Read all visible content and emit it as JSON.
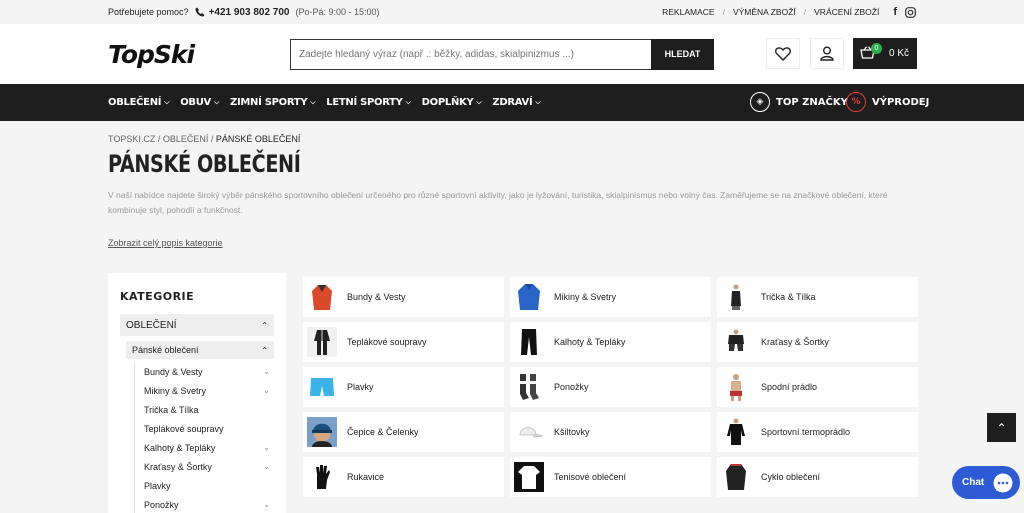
{
  "topbar": {
    "help": "Potřebujete pomoc?",
    "phone": "+421 903 802 700",
    "hours": "(Po-Pá: 9:00 - 15:00)",
    "links": [
      "REKLAMACE",
      "VÝMĚNA ZBOŽÍ",
      "VRÁCENÍ ZBOŽÍ"
    ]
  },
  "header": {
    "logo": "TopSki",
    "search_placeholder": "Zadejte hledaný výraz (např .: běžky, adidas, skialpinizmus ...)",
    "search_button": "HLEDAT",
    "cart_count": "0",
    "cart_total": "0 Kč"
  },
  "nav": {
    "items": [
      "OBLEČENÍ",
      "OBUV",
      "ZIMNÍ SPORTY",
      "LETNÍ SPORTY",
      "DOPLŇKY",
      "ZDRAVÍ"
    ],
    "top_brands": "TOP ZNAČKY",
    "sale": "VÝPRODEJ"
  },
  "breadcrumb": {
    "items": [
      "TOPSKI.CZ",
      "OBLEČENÍ"
    ],
    "current": "PÁNSKÉ OBLEČENÍ"
  },
  "page": {
    "title": "PÁNSKÉ OBLEČENÍ",
    "description": "V naší nabídce najdete široký výběr pánského sportovního oblečení určeného pro různé sportovní aktivity, jako je lyžování, turistika, skialpinismus nebo volný čas. Zaměřujeme se na značkové oblečení, které kombinuje styl, pohodlí a funkčnost.",
    "more": "Zobrazit celý popis kategorie"
  },
  "sidebar": {
    "heading": "KATEGORIE",
    "level1": "OBLEČENÍ",
    "level2": "Pánské oblečení",
    "items": [
      {
        "label": "Bundy & Vesty",
        "expandable": true
      },
      {
        "label": "Mikiny & Svetry",
        "expandable": true
      },
      {
        "label": "Trička & Tílka",
        "expandable": false
      },
      {
        "label": "Teplákové soupravy",
        "expandable": false
      },
      {
        "label": "Kalhoty & Tepláky",
        "expandable": true
      },
      {
        "label": "Kraťasy & Šortky",
        "expandable": true
      },
      {
        "label": "Plavky",
        "expandable": false
      },
      {
        "label": "Ponožky",
        "expandable": true
      }
    ]
  },
  "categories": [
    {
      "label": "Bundy & Vesty",
      "icon": "jacket-icon",
      "color": "#d84a2a"
    },
    {
      "label": "Mikiny & Svetry",
      "icon": "hoodie-icon",
      "color": "#2a64c8"
    },
    {
      "label": "Trička & Tílka",
      "icon": "tank-top-icon",
      "color": "#222222"
    },
    {
      "label": "Teplákové soupravy",
      "icon": "tracksuit-icon",
      "color": "#222222"
    },
    {
      "label": "Kalhoty & Tepláky",
      "icon": "pants-icon",
      "color": "#111111"
    },
    {
      "label": "Kraťasy & Šortky",
      "icon": "shorts-icon",
      "color": "#222222"
    },
    {
      "label": "Plavky",
      "icon": "swim-shorts-icon",
      "color": "#3ab4e8"
    },
    {
      "label": "Ponožky",
      "icon": "socks-icon",
      "color": "#333333"
    },
    {
      "label": "Spodní prádlo",
      "icon": "underwear-icon",
      "color": "#c03030"
    },
    {
      "label": "Čepice & Čelenky",
      "icon": "beanie-icon",
      "color": "#1a4f7a"
    },
    {
      "label": "Kšiltovky",
      "icon": "cap-icon",
      "color": "#eeeeee"
    },
    {
      "label": "Sportovní termoprádlo",
      "icon": "base-layer-icon",
      "color": "#111111"
    },
    {
      "label": "Rukavice",
      "icon": "gloves-icon",
      "color": "#111111"
    },
    {
      "label": "Tenisové oblečení",
      "icon": "tennis-shirt-icon",
      "color": "#ffffff"
    },
    {
      "label": "Cyklo oblečení",
      "icon": "cycling-jersey-icon",
      "color": "#222222"
    }
  ],
  "chat": {
    "label": "Chat"
  }
}
